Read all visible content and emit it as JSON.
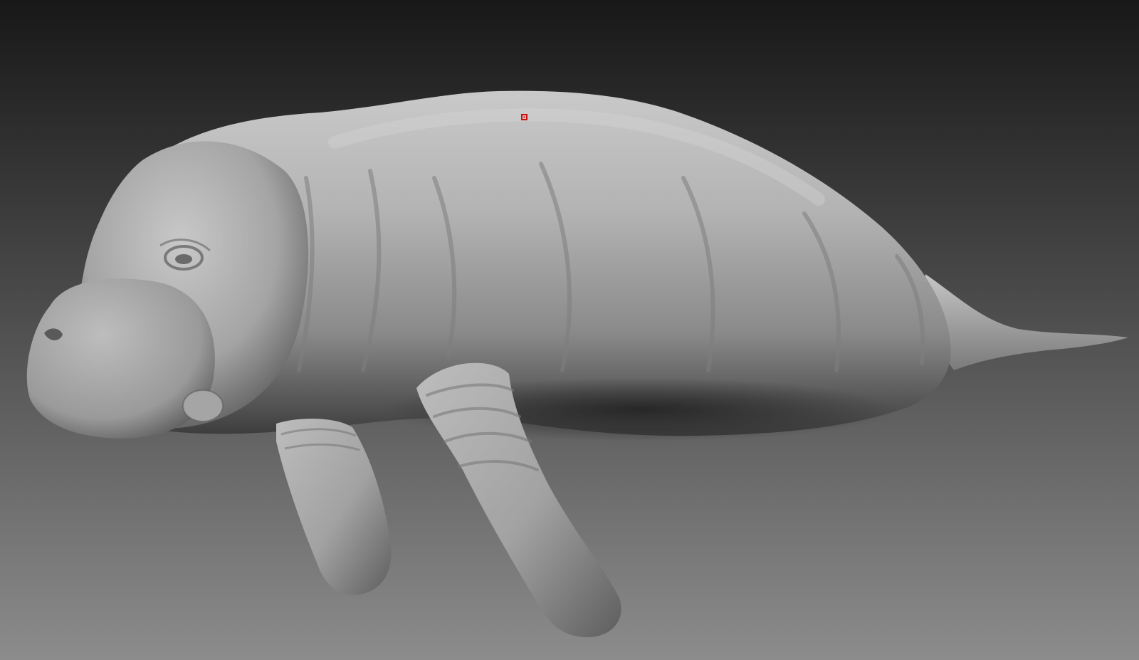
{
  "viewport": {
    "background_top": "#181818",
    "background_bottom": "#8c8c8c",
    "model_tone_light": "#c4c4c4",
    "model_tone_mid": "#9a9a9a",
    "model_tone_dark": "#3a3a3a",
    "cursor_color": "#cc1111"
  },
  "model": {
    "subject": "manatee-sculpt",
    "material": "matcap-gray"
  },
  "cursor": {
    "icon": "brush-cursor-dot"
  }
}
